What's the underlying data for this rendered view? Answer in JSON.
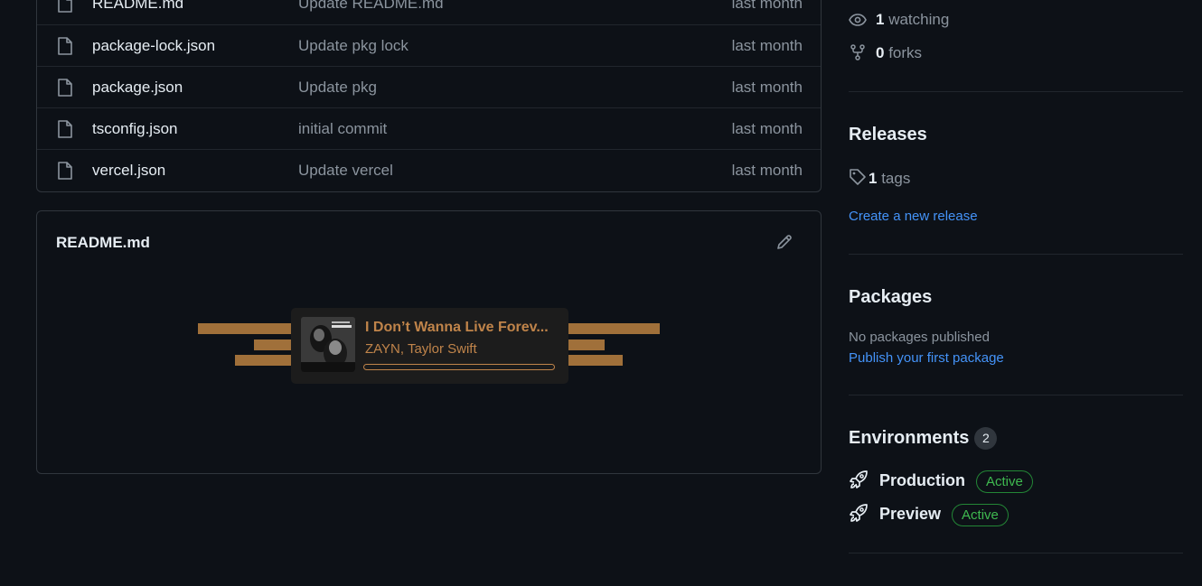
{
  "files": [
    {
      "name": "README.md",
      "message": "Update README.md",
      "date": "last month"
    },
    {
      "name": "package-lock.json",
      "message": "Update pkg lock",
      "date": "last month"
    },
    {
      "name": "package.json",
      "message": "Update pkg",
      "date": "last month"
    },
    {
      "name": "tsconfig.json",
      "message": "initial commit",
      "date": "last month"
    },
    {
      "name": "vercel.json",
      "message": "Update vercel",
      "date": "last month"
    }
  ],
  "readme": {
    "title": "README.md",
    "now_playing": {
      "song": "I Don’t Wanna Live Forev...",
      "artist": "ZAYN, Taylor Swift",
      "progress": 0.0,
      "accent": "#c0844a",
      "bar_color": "#a0703a"
    }
  },
  "sidebar": {
    "watching_count": "1",
    "watching_label": "watching",
    "forks_count": "0",
    "forks_label": "forks",
    "releases": {
      "heading": "Releases",
      "tags_count": "1",
      "tags_label": "tags",
      "create_link": "Create a new release"
    },
    "packages": {
      "heading": "Packages",
      "empty_text": "No packages published",
      "publish_link": "Publish your first package"
    },
    "environments": {
      "heading": "Environments",
      "count": "2",
      "items": [
        {
          "name": "Production",
          "status": "Active"
        },
        {
          "name": "Preview",
          "status": "Active"
        }
      ]
    }
  },
  "colors": {
    "background": "#0d1117",
    "link": "#4493f8",
    "success": "#3fb950"
  }
}
